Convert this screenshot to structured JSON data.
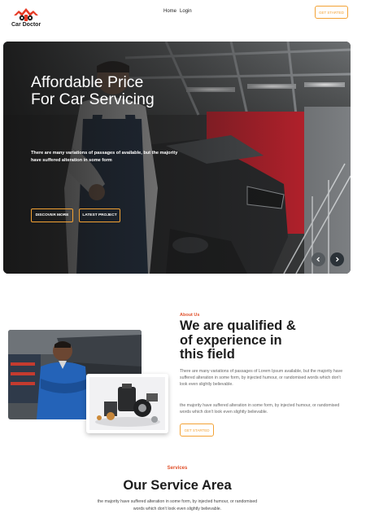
{
  "header": {
    "logo_text": "Car Doctor",
    "nav": [
      "Home",
      "Login"
    ],
    "cta_label": "GET STARTED"
  },
  "hero": {
    "title": "Affordable Price For Car Servicing",
    "description": "There are many variations of passages of available, but the majority have suffered alteration in some form",
    "primary_button": "DISCOVER MORE",
    "secondary_button": "LATEST PROJECT",
    "prev_icon": "chevron-left-icon",
    "next_icon": "chevron-right-icon"
  },
  "about": {
    "label": "About Us",
    "title": "We are qualified & of experience in this field",
    "paragraph_1": "There are many variations of passages of Lorem Ipsum available, but the majority have suffered alteration in some form, by injected humour, or randomised words which don't look even slightly believable.",
    "paragraph_2": "the majority have suffered alteration in some form, by injected humour, or randomised words which don't look even slightly believable.",
    "button": "GET STARTED"
  },
  "services": {
    "label": "Services",
    "title": "Our Service Area",
    "description": "the majority have suffered alteration in some form, by injected humour, or randomised words which don't look even slightly believable."
  },
  "colors": {
    "accent": "#f3a234",
    "brand_red": "#e0502a",
    "text_dark": "#1c1c1c"
  }
}
